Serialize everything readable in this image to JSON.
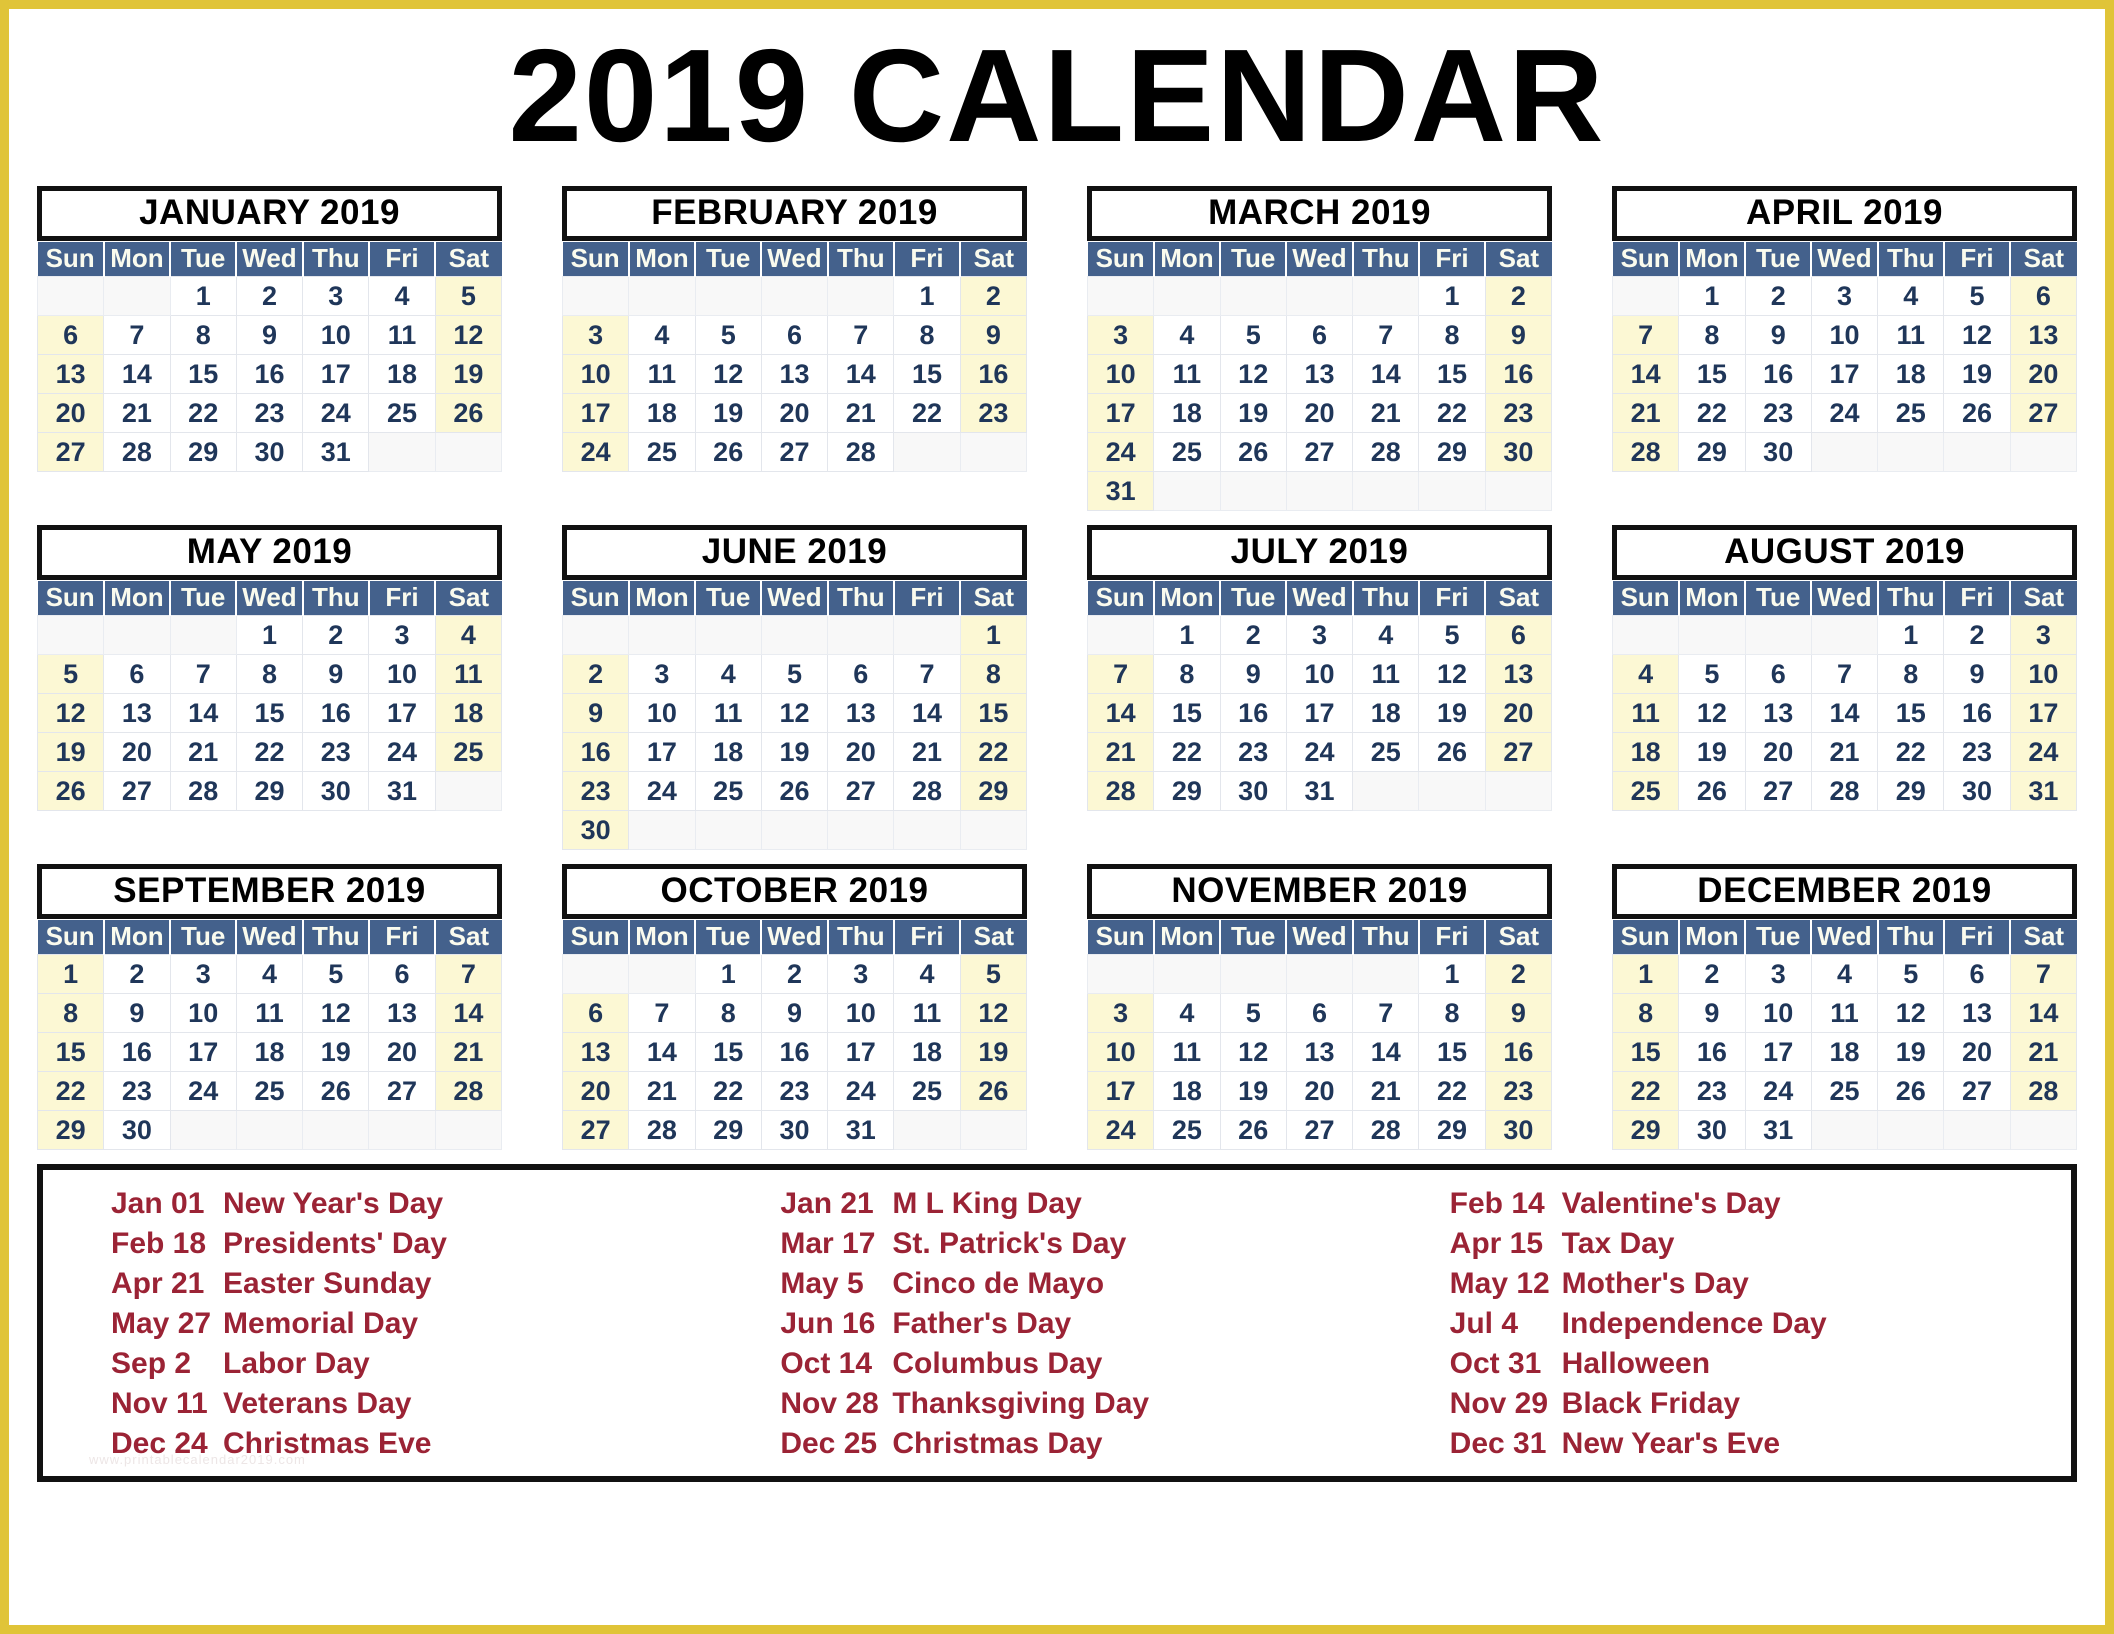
{
  "page": {
    "title": "2019 CALENDAR",
    "border_color": "#E0C438",
    "header_bg_color": "#44618C",
    "weekend_bg_color": "#FCF8D4",
    "day_text_color": "#1F3659",
    "holiday_text_color": "#9B2335",
    "watermark": "www.printablecalendar2019.com"
  },
  "weekdays": [
    "Sun",
    "Mon",
    "Tue",
    "Wed",
    "Thu",
    "Fri",
    "Sat"
  ],
  "months": [
    {
      "name": "JANUARY 2019",
      "weeks": [
        [
          "",
          "",
          "1",
          "2",
          "3",
          "4",
          "5"
        ],
        [
          "6",
          "7",
          "8",
          "9",
          "10",
          "11",
          "12"
        ],
        [
          "13",
          "14",
          "15",
          "16",
          "17",
          "18",
          "19"
        ],
        [
          "20",
          "21",
          "22",
          "23",
          "24",
          "25",
          "26"
        ],
        [
          "27",
          "28",
          "29",
          "30",
          "31",
          "",
          ""
        ]
      ]
    },
    {
      "name": "FEBRUARY 2019",
      "weeks": [
        [
          "",
          "",
          "",
          "",
          "",
          "1",
          "2"
        ],
        [
          "3",
          "4",
          "5",
          "6",
          "7",
          "8",
          "9"
        ],
        [
          "10",
          "11",
          "12",
          "13",
          "14",
          "15",
          "16"
        ],
        [
          "17",
          "18",
          "19",
          "20",
          "21",
          "22",
          "23"
        ],
        [
          "24",
          "25",
          "26",
          "27",
          "28",
          "",
          ""
        ]
      ]
    },
    {
      "name": "MARCH 2019",
      "weeks": [
        [
          "",
          "",
          "",
          "",
          "",
          "1",
          "2"
        ],
        [
          "3",
          "4",
          "5",
          "6",
          "7",
          "8",
          "9"
        ],
        [
          "10",
          "11",
          "12",
          "13",
          "14",
          "15",
          "16"
        ],
        [
          "17",
          "18",
          "19",
          "20",
          "21",
          "22",
          "23"
        ],
        [
          "24",
          "25",
          "26",
          "27",
          "28",
          "29",
          "30"
        ],
        [
          "31",
          "",
          "",
          "",
          "",
          "",
          ""
        ]
      ]
    },
    {
      "name": "APRIL 2019",
      "weeks": [
        [
          "",
          "1",
          "2",
          "3",
          "4",
          "5",
          "6"
        ],
        [
          "7",
          "8",
          "9",
          "10",
          "11",
          "12",
          "13"
        ],
        [
          "14",
          "15",
          "16",
          "17",
          "18",
          "19",
          "20"
        ],
        [
          "21",
          "22",
          "23",
          "24",
          "25",
          "26",
          "27"
        ],
        [
          "28",
          "29",
          "30",
          "",
          "",
          "",
          ""
        ]
      ]
    },
    {
      "name": "MAY 2019",
      "weeks": [
        [
          "",
          "",
          "",
          "1",
          "2",
          "3",
          "4"
        ],
        [
          "5",
          "6",
          "7",
          "8",
          "9",
          "10",
          "11"
        ],
        [
          "12",
          "13",
          "14",
          "15",
          "16",
          "17",
          "18"
        ],
        [
          "19",
          "20",
          "21",
          "22",
          "23",
          "24",
          "25"
        ],
        [
          "26",
          "27",
          "28",
          "29",
          "30",
          "31",
          ""
        ]
      ]
    },
    {
      "name": "JUNE 2019",
      "weeks": [
        [
          "",
          "",
          "",
          "",
          "",
          "",
          "1"
        ],
        [
          "2",
          "3",
          "4",
          "5",
          "6",
          "7",
          "8"
        ],
        [
          "9",
          "10",
          "11",
          "12",
          "13",
          "14",
          "15"
        ],
        [
          "16",
          "17",
          "18",
          "19",
          "20",
          "21",
          "22"
        ],
        [
          "23",
          "24",
          "25",
          "26",
          "27",
          "28",
          "29"
        ],
        [
          "30",
          "",
          "",
          "",
          "",
          "",
          ""
        ]
      ]
    },
    {
      "name": "JULY 2019",
      "weeks": [
        [
          "",
          "1",
          "2",
          "3",
          "4",
          "5",
          "6"
        ],
        [
          "7",
          "8",
          "9",
          "10",
          "11",
          "12",
          "13"
        ],
        [
          "14",
          "15",
          "16",
          "17",
          "18",
          "19",
          "20"
        ],
        [
          "21",
          "22",
          "23",
          "24",
          "25",
          "26",
          "27"
        ],
        [
          "28",
          "29",
          "30",
          "31",
          "",
          "",
          ""
        ]
      ]
    },
    {
      "name": "AUGUST 2019",
      "weeks": [
        [
          "",
          "",
          "",
          "",
          "1",
          "2",
          "3"
        ],
        [
          "4",
          "5",
          "6",
          "7",
          "8",
          "9",
          "10"
        ],
        [
          "11",
          "12",
          "13",
          "14",
          "15",
          "16",
          "17"
        ],
        [
          "18",
          "19",
          "20",
          "21",
          "22",
          "23",
          "24"
        ],
        [
          "25",
          "26",
          "27",
          "28",
          "29",
          "30",
          "31"
        ]
      ]
    },
    {
      "name": "SEPTEMBER 2019",
      "weeks": [
        [
          "1",
          "2",
          "3",
          "4",
          "5",
          "6",
          "7"
        ],
        [
          "8",
          "9",
          "10",
          "11",
          "12",
          "13",
          "14"
        ],
        [
          "15",
          "16",
          "17",
          "18",
          "19",
          "20",
          "21"
        ],
        [
          "22",
          "23",
          "24",
          "25",
          "26",
          "27",
          "28"
        ],
        [
          "29",
          "30",
          "",
          "",
          "",
          "",
          ""
        ]
      ]
    },
    {
      "name": "OCTOBER 2019",
      "weeks": [
        [
          "",
          "",
          "1",
          "2",
          "3",
          "4",
          "5"
        ],
        [
          "6",
          "7",
          "8",
          "9",
          "10",
          "11",
          "12"
        ],
        [
          "13",
          "14",
          "15",
          "16",
          "17",
          "18",
          "19"
        ],
        [
          "20",
          "21",
          "22",
          "23",
          "24",
          "25",
          "26"
        ],
        [
          "27",
          "28",
          "29",
          "30",
          "31",
          "",
          ""
        ]
      ]
    },
    {
      "name": "NOVEMBER 2019",
      "weeks": [
        [
          "",
          "",
          "",
          "",
          "",
          "1",
          "2"
        ],
        [
          "3",
          "4",
          "5",
          "6",
          "7",
          "8",
          "9"
        ],
        [
          "10",
          "11",
          "12",
          "13",
          "14",
          "15",
          "16"
        ],
        [
          "17",
          "18",
          "19",
          "20",
          "21",
          "22",
          "23"
        ],
        [
          "24",
          "25",
          "26",
          "27",
          "28",
          "29",
          "30"
        ]
      ]
    },
    {
      "name": "DECEMBER 2019",
      "weeks": [
        [
          "1",
          "2",
          "3",
          "4",
          "5",
          "6",
          "7"
        ],
        [
          "8",
          "9",
          "10",
          "11",
          "12",
          "13",
          "14"
        ],
        [
          "15",
          "16",
          "17",
          "18",
          "19",
          "20",
          "21"
        ],
        [
          "22",
          "23",
          "24",
          "25",
          "26",
          "27",
          "28"
        ],
        [
          "29",
          "30",
          "31",
          "",
          "",
          "",
          ""
        ]
      ]
    }
  ],
  "holiday_columns": [
    [
      {
        "date": "Jan 01",
        "name": "New Year's Day"
      },
      {
        "date": "Feb 18",
        "name": "Presidents' Day"
      },
      {
        "date": "Apr 21",
        "name": "Easter Sunday"
      },
      {
        "date": "May 27",
        "name": "Memorial Day"
      },
      {
        "date": "Sep 2",
        "name": "Labor Day"
      },
      {
        "date": "Nov 11",
        "name": "Veterans Day"
      },
      {
        "date": "Dec 24",
        "name": "Christmas Eve"
      }
    ],
    [
      {
        "date": "Jan 21",
        "name": "M L King Day"
      },
      {
        "date": "Mar 17",
        "name": "St. Patrick's Day"
      },
      {
        "date": "May 5",
        "name": "Cinco de Mayo"
      },
      {
        "date": "Jun 16",
        "name": "Father's Day"
      },
      {
        "date": "Oct 14",
        "name": "Columbus Day"
      },
      {
        "date": "Nov 28",
        "name": "Thanksgiving Day"
      },
      {
        "date": "Dec 25",
        "name": "Christmas Day"
      }
    ],
    [
      {
        "date": "Feb 14",
        "name": "Valentine's Day"
      },
      {
        "date": "Apr 15",
        "name": "Tax Day"
      },
      {
        "date": "May 12",
        "name": "Mother's Day"
      },
      {
        "date": "Jul 4",
        "name": "Independence Day"
      },
      {
        "date": "Oct 31",
        "name": "Halloween"
      },
      {
        "date": "Nov 29",
        "name": "Black Friday"
      },
      {
        "date": "Dec 31",
        "name": "New Year's Eve"
      }
    ]
  ]
}
